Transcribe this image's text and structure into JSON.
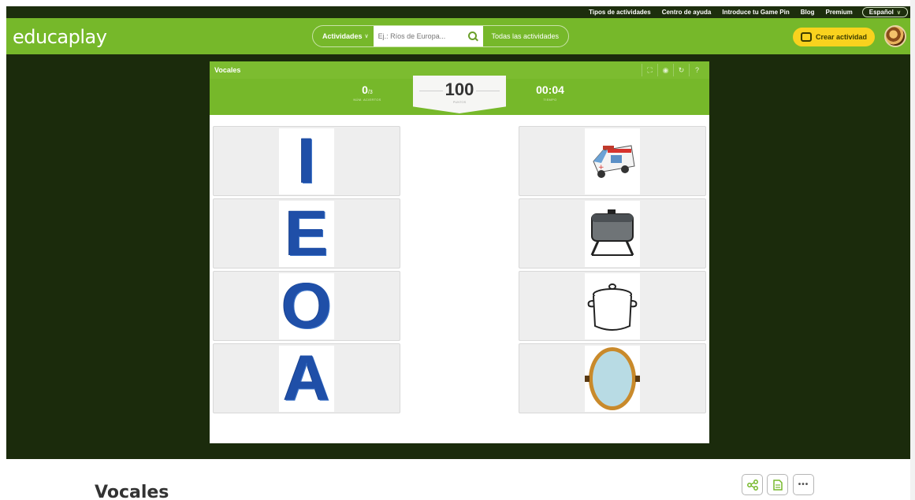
{
  "topbar": {
    "links": [
      "Tipos de actividades",
      "Centro de ayuda",
      "Introduce tu Game Pin",
      "Blog",
      "Premium"
    ],
    "language": "Español"
  },
  "header": {
    "logo": "educaplay",
    "activities_label": "Actividades",
    "search_placeholder": "Ej.: Ríos de Europa...",
    "all_activities": "Todas las actividades",
    "create_label": "Crear actividad"
  },
  "game": {
    "title": "Vocales",
    "tools": [
      "fullscreen-icon",
      "sound-icon",
      "restart-icon",
      "help-icon"
    ],
    "hits": "0",
    "hits_total": "/3",
    "hits_label": "NÚM. ACIERTOS",
    "points": "100",
    "points_label": "PUNTOS",
    "time": "00:04",
    "time_label": "TIEMPO",
    "left_cards": [
      "I",
      "E",
      "O",
      "A"
    ],
    "right_cards": [
      "ambulance-image",
      "grill-image",
      "pot-image",
      "mirror-image"
    ]
  },
  "page": {
    "title": "Vocales",
    "actions": [
      "share-icon",
      "document-icon",
      "more-icon"
    ]
  },
  "colors": {
    "green": "#76b82a",
    "dark": "#1b2b0c",
    "yellow": "#f9d21e",
    "letter_blue": "#1f4fa8"
  }
}
